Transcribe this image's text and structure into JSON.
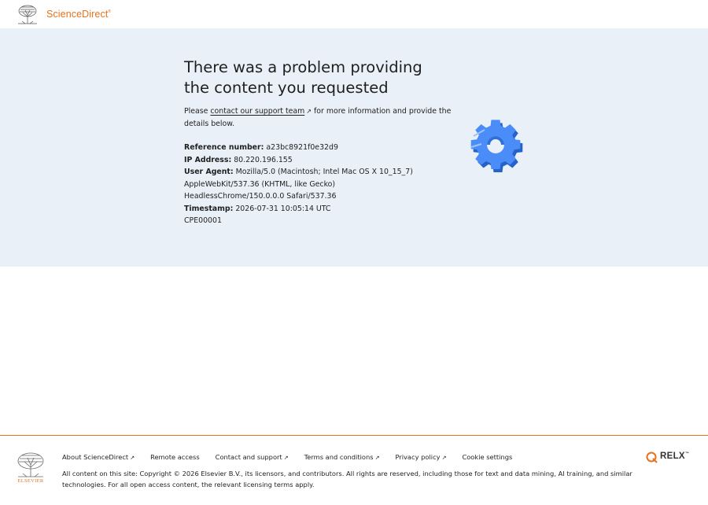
{
  "header": {
    "brand": "ScienceDirect",
    "brand_mark": "®"
  },
  "error": {
    "title": "There was a problem providing the content you requested",
    "intro_before": "Please ",
    "support_link": "contact our support team",
    "intro_after": "for more information and provide the details below.",
    "reference_label": "Reference number:",
    "reference_value": "a23bc8921f0e32d9",
    "ip_label": "IP Address:",
    "ip_value": "80.220.196.155",
    "ua_label": "User Agent:",
    "ua_value": "Mozilla/5.0 (Macintosh; Intel Mac OS X 10_15_7) AppleWebKit/537.36 (KHTML, like Gecko) HeadlessChrome/150.0.0.0 Safari/537.36",
    "timestamp_label": "Timestamp:",
    "timestamp_value": "2026-07-31 10:05:14 UTC",
    "code": "CPE00001",
    "illustration_icon": "gear-icon"
  },
  "footer": {
    "links": [
      {
        "label": "About ScienceDirect",
        "external": "↗"
      },
      {
        "label": "Remote access",
        "external": ""
      },
      {
        "label": "Contact and support",
        "external": "↗"
      },
      {
        "label": "Terms and conditions",
        "external": "↗"
      },
      {
        "label": "Privacy policy",
        "external": "↗"
      },
      {
        "label": "Cookie settings",
        "external": ""
      }
    ],
    "copyright": "All content on this site: Copyright © 2026 Elsevier B.V., its licensors, and contributors. All rights are reserved, including those for text and data mining, AI training, and similar technologies. For all open access content, the relevant licensing terms apply.",
    "elsevier_word": "ELSEVIER",
    "relx_word": "RELX",
    "relx_mark": "™"
  },
  "colors": {
    "brand_orange": "#e9711c",
    "band_bg": "#e9f0f8",
    "gear_blue": "#3b82f6"
  }
}
